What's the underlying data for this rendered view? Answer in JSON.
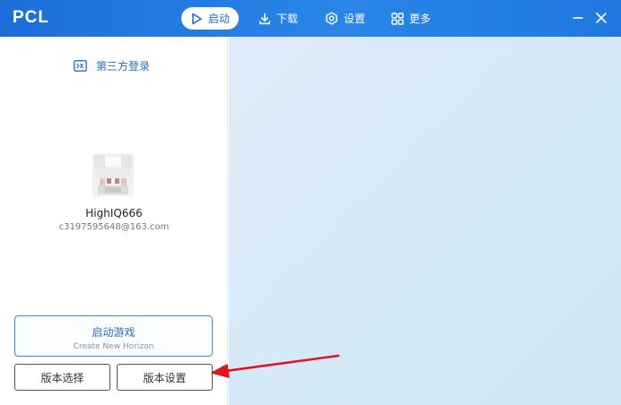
{
  "app": {
    "title": "PCL"
  },
  "nav": {
    "launch": "启动",
    "download": "下载",
    "settings": "设置",
    "more": "更多"
  },
  "account": {
    "login_type": "第三方登录",
    "username": "HighIQ666",
    "email": "c3197595648@163.com"
  },
  "actions": {
    "launch_game": "启动游戏",
    "launch_subtitle": "Create New Horizon",
    "version_select": "版本选择",
    "version_settings": "版本设置"
  },
  "colors": {
    "accent": "#1b6fd8",
    "annotation_arrow": "#e0161b"
  },
  "icons": {
    "launch": "play-icon",
    "download": "download-icon",
    "settings": "gear-icon",
    "more": "grid-icon",
    "login": "id-card-icon"
  }
}
